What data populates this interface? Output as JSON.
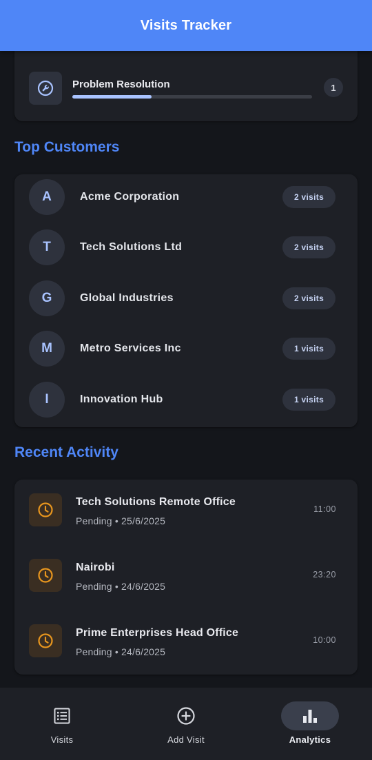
{
  "app": {
    "title": "Visits Tracker"
  },
  "categories": [
    {
      "label": "Problem Resolution",
      "count": "1",
      "progress": 0.33
    }
  ],
  "top_customers": {
    "title": "Top Customers",
    "items": [
      {
        "initial": "A",
        "name": "Acme Corporation",
        "visits": "2 visits"
      },
      {
        "initial": "T",
        "name": "Tech Solutions Ltd",
        "visits": "2 visits"
      },
      {
        "initial": "G",
        "name": "Global Industries",
        "visits": "2 visits"
      },
      {
        "initial": "M",
        "name": "Metro Services Inc",
        "visits": "1 visits"
      },
      {
        "initial": "I",
        "name": "Innovation Hub",
        "visits": "1 visits"
      }
    ]
  },
  "recent_activity": {
    "title": "Recent Activity",
    "items": [
      {
        "title": "Tech Solutions Remote Office",
        "subtitle": "Pending • 25/6/2025",
        "time": "11:00",
        "icon": "clock-icon"
      },
      {
        "title": "Nairobi",
        "subtitle": "Pending • 24/6/2025",
        "time": "23:20",
        "icon": "clock-icon"
      },
      {
        "title": "Prime Enterprises Head Office",
        "subtitle": "Pending • 24/6/2025",
        "time": "10:00",
        "icon": "clock-icon"
      }
    ]
  },
  "bottom_nav": {
    "items": [
      {
        "label": "Visits",
        "icon": "list-icon",
        "active": false
      },
      {
        "label": "Add Visit",
        "icon": "add-circle-icon",
        "active": false
      },
      {
        "label": "Analytics",
        "icon": "bar-chart-icon",
        "active": true
      }
    ]
  },
  "colors": {
    "primary": "#4f86f7",
    "background": "#14161b",
    "card": "#1e2026",
    "pending_accent": "#e8961e"
  }
}
